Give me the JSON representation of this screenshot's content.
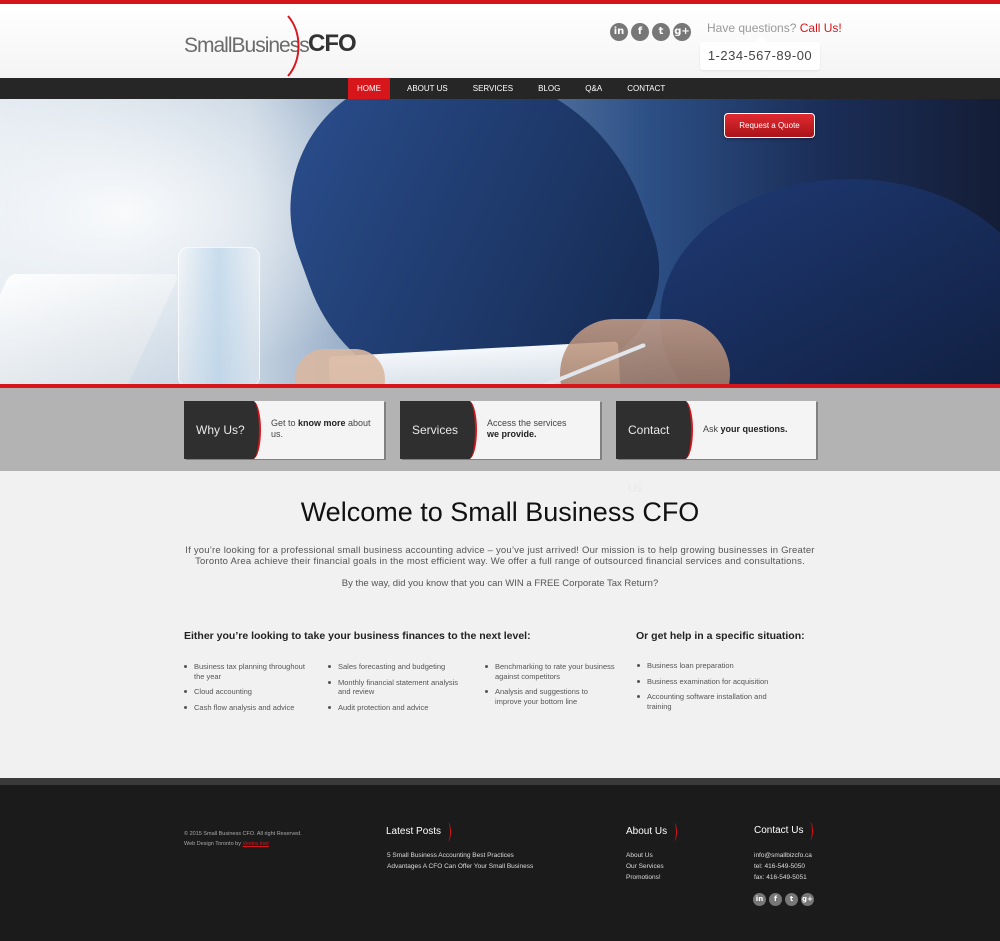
{
  "header": {
    "logo_left": "SmallBusiness",
    "logo_right": "CFO",
    "social": [
      "in",
      "f",
      "t",
      "g+"
    ],
    "questions": "Have questions?",
    "call_us": "Call Us!",
    "phone": "1-234-567-89-00"
  },
  "nav": {
    "items": [
      "HOME",
      "ABOUT US",
      "SERVICES",
      "BLOG",
      "Q&A",
      "CONTACT"
    ],
    "active": "HOME"
  },
  "hero": {
    "button": "Request a Quote"
  },
  "boxes": [
    {
      "title": "Why Us?",
      "text_pre": "Get to ",
      "text_bold": "know more",
      "text_post": " about us."
    },
    {
      "title": "Services",
      "text_pre": "Access the services ",
      "text_bold": "we provide.",
      "text_post": ""
    },
    {
      "title": "Contact Us",
      "text_pre": "Ask ",
      "text_bold": "your questions.",
      "text_post": ""
    }
  ],
  "welcome": {
    "title": "Welcome to Small Business CFO",
    "intro": "If you’re looking for a professional small business accounting advice – you’ve just arrived! Our mission is to help growing businesses in Greater Toronto Area achieve their financial goals in the most efficient way. We offer a full range of outsourced financial services and consultations.",
    "intro2": "By the way, did you know that you can WIN a FREE Corporate Tax Return?"
  },
  "sections": {
    "left_heading": "Either you’re looking to take your business finances to the next level:",
    "right_heading": "Or get help in a specific situation:",
    "col1": [
      "Business tax planning throughout the year",
      "Cloud accounting",
      "Cash flow analysis and advice"
    ],
    "col2": [
      "Sales forecasting and budgeting",
      "Monthly financial statement analysis and review",
      "Audit protection and advice"
    ],
    "col3": [
      "Benchmarking to rate your business against competitors",
      "Analysis and suggestions to improve your bottom line"
    ],
    "col4": [
      "Business loan preparation",
      "Business examination for acquisition",
      "Accounting software installation and training"
    ]
  },
  "footer": {
    "copyright": "© 2015 Small Business CFO. All right Reserved.",
    "design_pre": "Web Design Toronto by ",
    "design_link": "Vestra Inet",
    "latest_posts": "Latest Posts",
    "posts": [
      "5 Small Business Accounting Best Practices",
      "Advantages A CFO Can Offer Your Small Business"
    ],
    "about_head": "About Us",
    "about_links": [
      "About Us",
      "Our Services",
      "Promotions!"
    ],
    "contact_head": "Contact Us",
    "email": "info@smallbizcfo.ca",
    "tel": "tel: 416-549-5050",
    "fax": "fax: 416-549-5051",
    "social": [
      "in",
      "f",
      "t",
      "g+"
    ]
  },
  "colors": {
    "accent": "#d7161c",
    "nav_bg": "#262626",
    "footer_bg": "#1b1b1b"
  }
}
